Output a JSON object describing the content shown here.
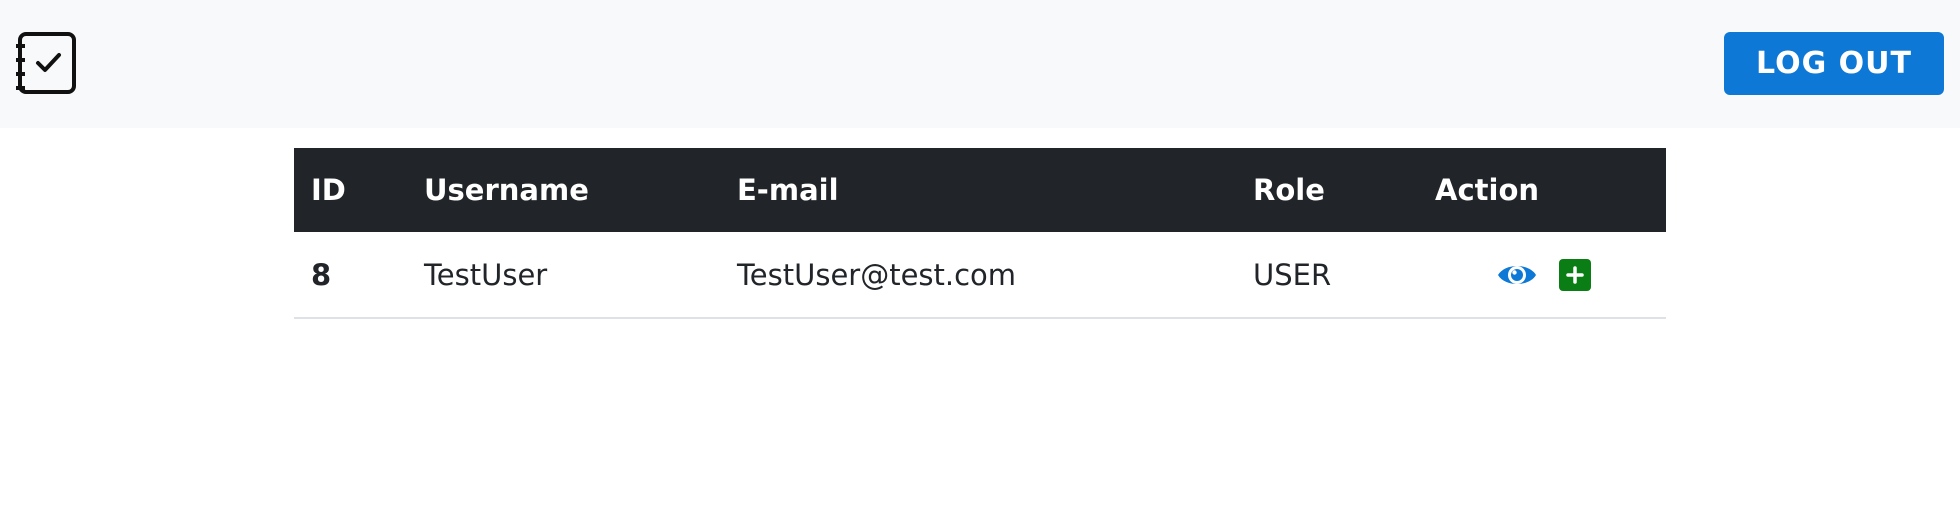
{
  "header": {
    "logo_icon": "journal-check-icon",
    "logout_label": "LOG OUT"
  },
  "table": {
    "columns": [
      "ID",
      "Username",
      "E-mail",
      "Role",
      "Action"
    ],
    "rows": [
      {
        "id": "8",
        "username": "TestUser",
        "email": "TestUser@test.com",
        "role": "USER",
        "actions": [
          "eye-icon",
          "plus-square-icon"
        ]
      }
    ]
  },
  "colors": {
    "navbar_bg": "#f8f9fa",
    "logout_bg": "#0d78d6",
    "table_header_bg": "#212529",
    "view_icon": "#0d78d6",
    "add_button": "#0a7d14"
  }
}
